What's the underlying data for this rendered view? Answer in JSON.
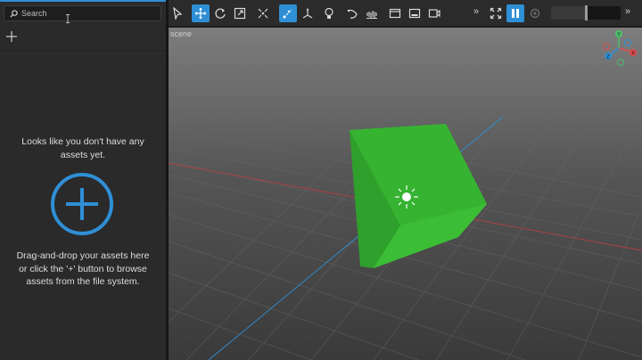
{
  "assets_panel": {
    "search_placeholder": "Search",
    "empty_line1": "Looks like you don't have any",
    "empty_line2": "assets yet.",
    "hint_line1": "Drag-and-drop your assets here",
    "hint_line2": "or click the '+' button to browse",
    "hint_line3": "assets from the file system."
  },
  "toolbar": {
    "tools": [
      {
        "icon": "select-icon",
        "active": false
      },
      {
        "icon": "move-icon",
        "active": true
      },
      {
        "icon": "rotate-icon",
        "active": false
      },
      {
        "icon": "scale-icon",
        "active": false
      },
      {
        "icon": "rect-transform-icon",
        "active": false
      },
      {
        "icon": "local-space-icon",
        "active": true
      },
      {
        "icon": "pivot-icon",
        "active": false
      },
      {
        "icon": "light-icon",
        "active": false
      },
      {
        "icon": "curve-icon",
        "active": false
      },
      {
        "icon": "audio-icon",
        "active": false
      },
      {
        "icon": "window-icon",
        "active": false
      },
      {
        "icon": "image-icon",
        "active": false
      },
      {
        "icon": "camera-icon",
        "active": false
      }
    ],
    "overflow_label": "»",
    "overflow_label_2": "»",
    "pause_active": true,
    "volume_level_percent": 50
  },
  "viewport": {
    "label": "scene",
    "gizmo_labels": {
      "y": "Y",
      "z": "Z",
      "x": "X"
    },
    "colors": {
      "cube": "#3fc23a",
      "x_axis": "#e04a4a",
      "y_axis": "#4ac26a",
      "z_axis": "#2f8fd6"
    }
  },
  "colors": {
    "accent": "#2f8fd6",
    "panel": "#2a2a2a",
    "toolbar": "#2b2b2b"
  }
}
